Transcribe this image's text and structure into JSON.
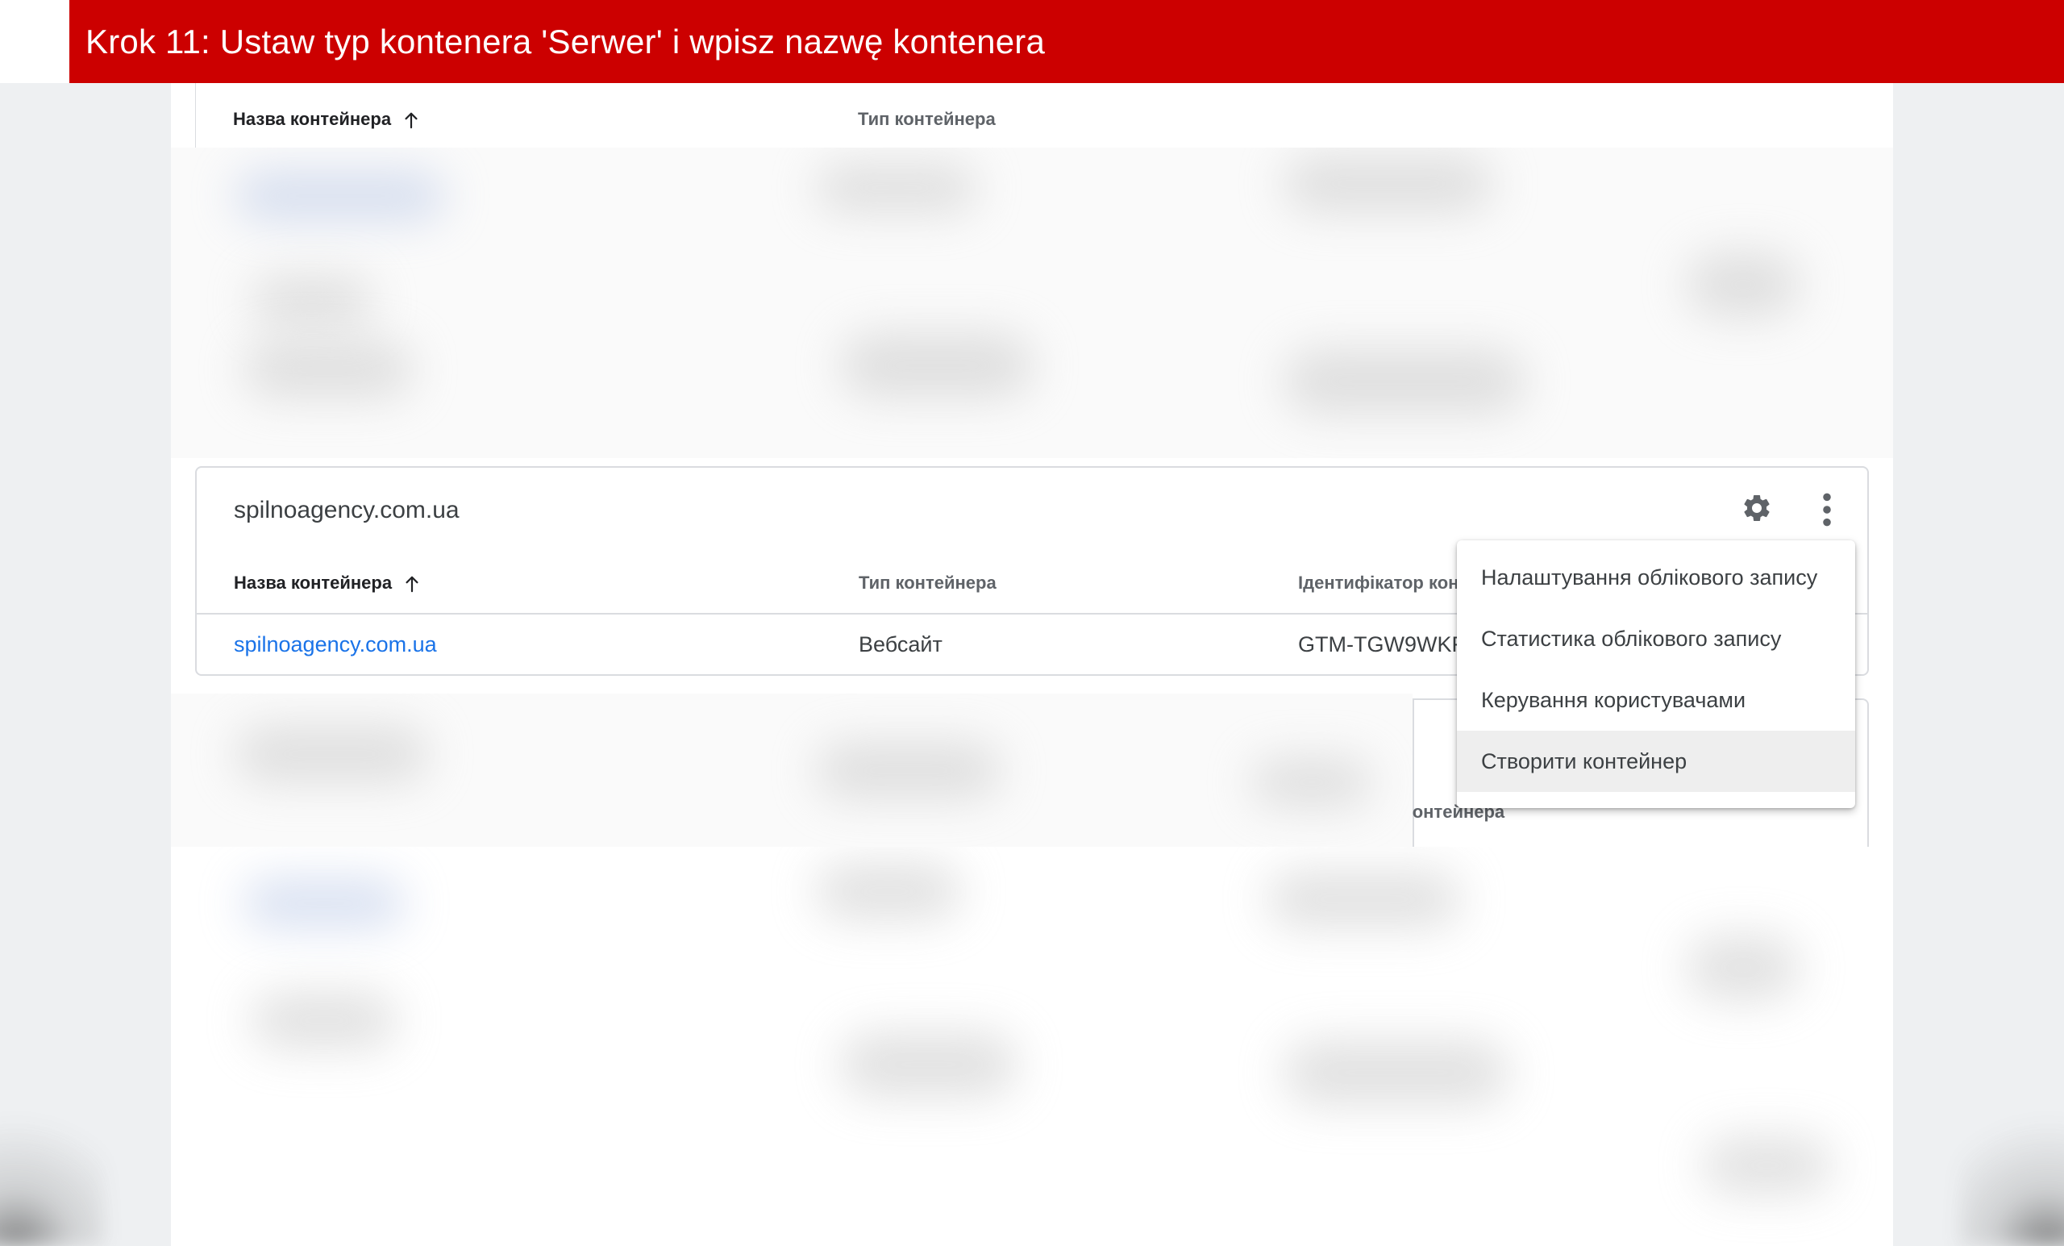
{
  "banner": {
    "title": "Krok 11: Ustaw typ kontenera 'Serwer' i wpisz nazwę kontenera"
  },
  "top_table": {
    "col_name": "Назва контейнера",
    "col_type": "Тип контейнера"
  },
  "account": {
    "title": "spilnoagency.com.ua",
    "columns": {
      "name": "Назва контейнера",
      "type": "Тип контейнера",
      "id": "Ідентифікатор кон"
    },
    "rows": [
      {
        "name": "spilnoagency.com.ua",
        "type": "Вебсайт",
        "id": "GTM-TGW9WKF"
      }
    ],
    "icons": {
      "settings": "gear-icon",
      "more": "more-vert-icon",
      "sort": "arrow-up-icon"
    }
  },
  "lower_card": {
    "col_id_partial": "ор контейнера"
  },
  "menu": {
    "items": [
      {
        "label": "Налаштування облікового запису"
      },
      {
        "label": "Статистика облікового запису"
      },
      {
        "label": "Керування користувачами"
      },
      {
        "label": "Створити контейнер",
        "active": true
      }
    ]
  },
  "colors": {
    "banner": "#cc0000",
    "link": "#1a73e8",
    "text": "#3c4043",
    "border": "#dadce0"
  }
}
